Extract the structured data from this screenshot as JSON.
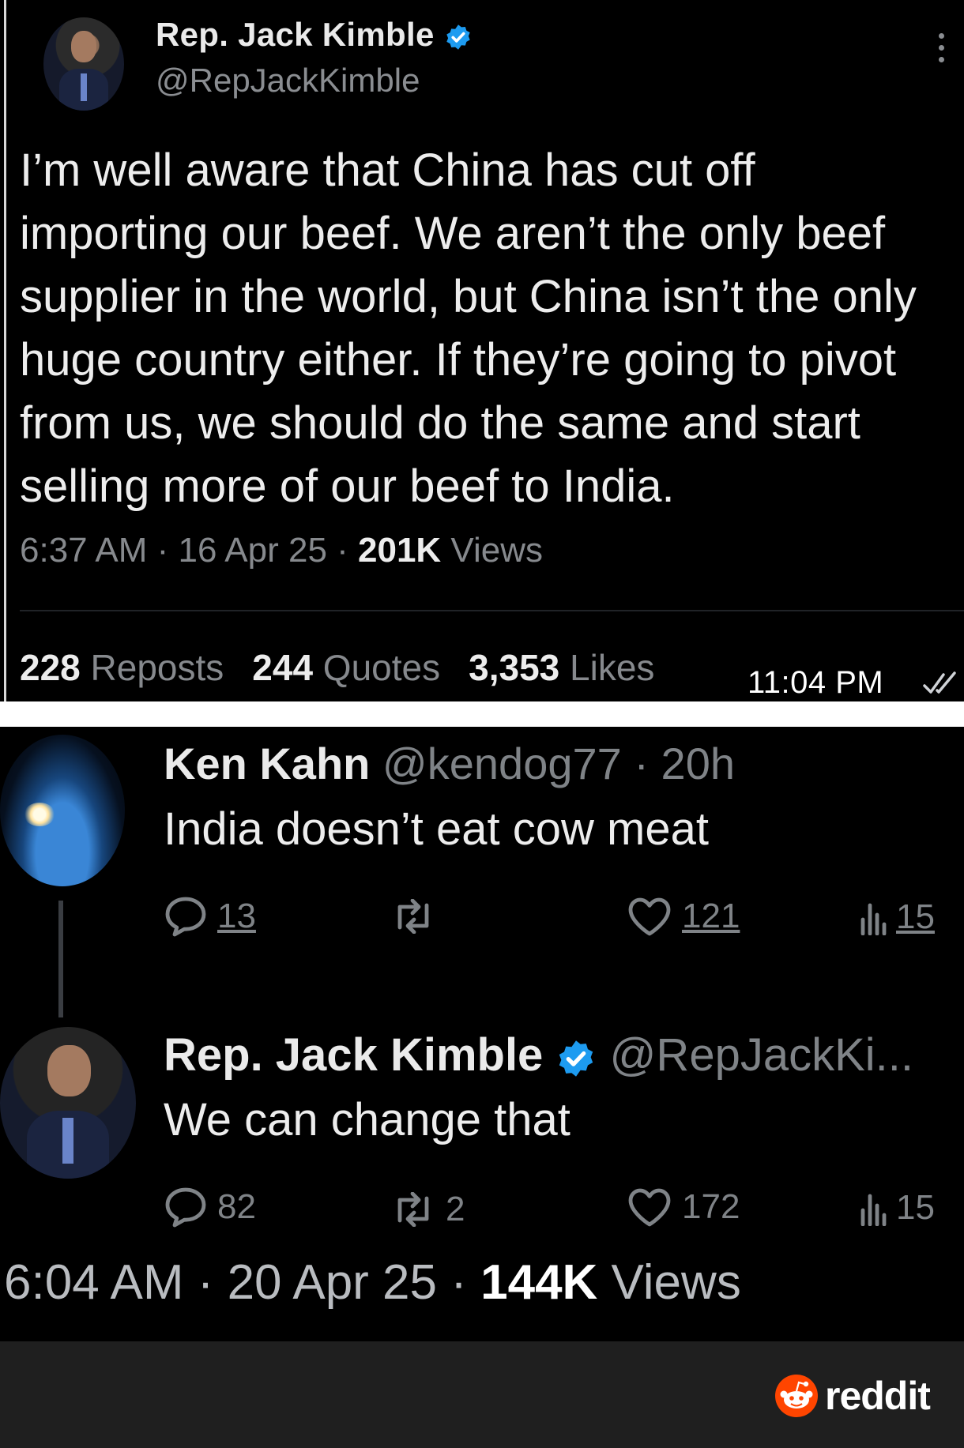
{
  "original_tweet": {
    "author_name": "Rep. Jack Kimble",
    "handle": "@RepJackKimble",
    "text": "I’m well aware that China has cut off importing our beef. We aren’t the only beef supplier in the world, but China isn’t the only huge country either. If they’re going to pivot from us, we should do the same and start selling more of our beef to India.",
    "time": "6:37 AM · 16 Apr 25 · ",
    "views_count": "201K",
    "views_label": " Views",
    "reposts_count": "228",
    "reposts_label": " Reposts",
    "quotes_count": "244",
    "quotes_label": " Quotes",
    "likes_count": "3,353",
    "likes_label": " Likes"
  },
  "message_bubble": {
    "time": "11:04 PM"
  },
  "reply_1": {
    "author_name": "Ken Kahn",
    "handle_time": " @kendog77 · 20h",
    "text": "India doesn’t eat cow meat",
    "replies": "13",
    "reposts": "",
    "likes": "121",
    "views": "15"
  },
  "reply_2": {
    "author_name": "Rep. Jack Kimble",
    "handle": " @RepJackKi...",
    "text": "We can change that",
    "replies": "82",
    "reposts": "2",
    "likes": "172",
    "views": "15",
    "footer_time": "6:04 AM · 20 Apr 25 · ",
    "footer_views_count": "144K",
    "footer_views_label": " Views"
  },
  "watermark": {
    "brand": "reddit"
  },
  "colors": {
    "verified": "#1d9bf0",
    "reddit_orange": "#ff4500"
  }
}
